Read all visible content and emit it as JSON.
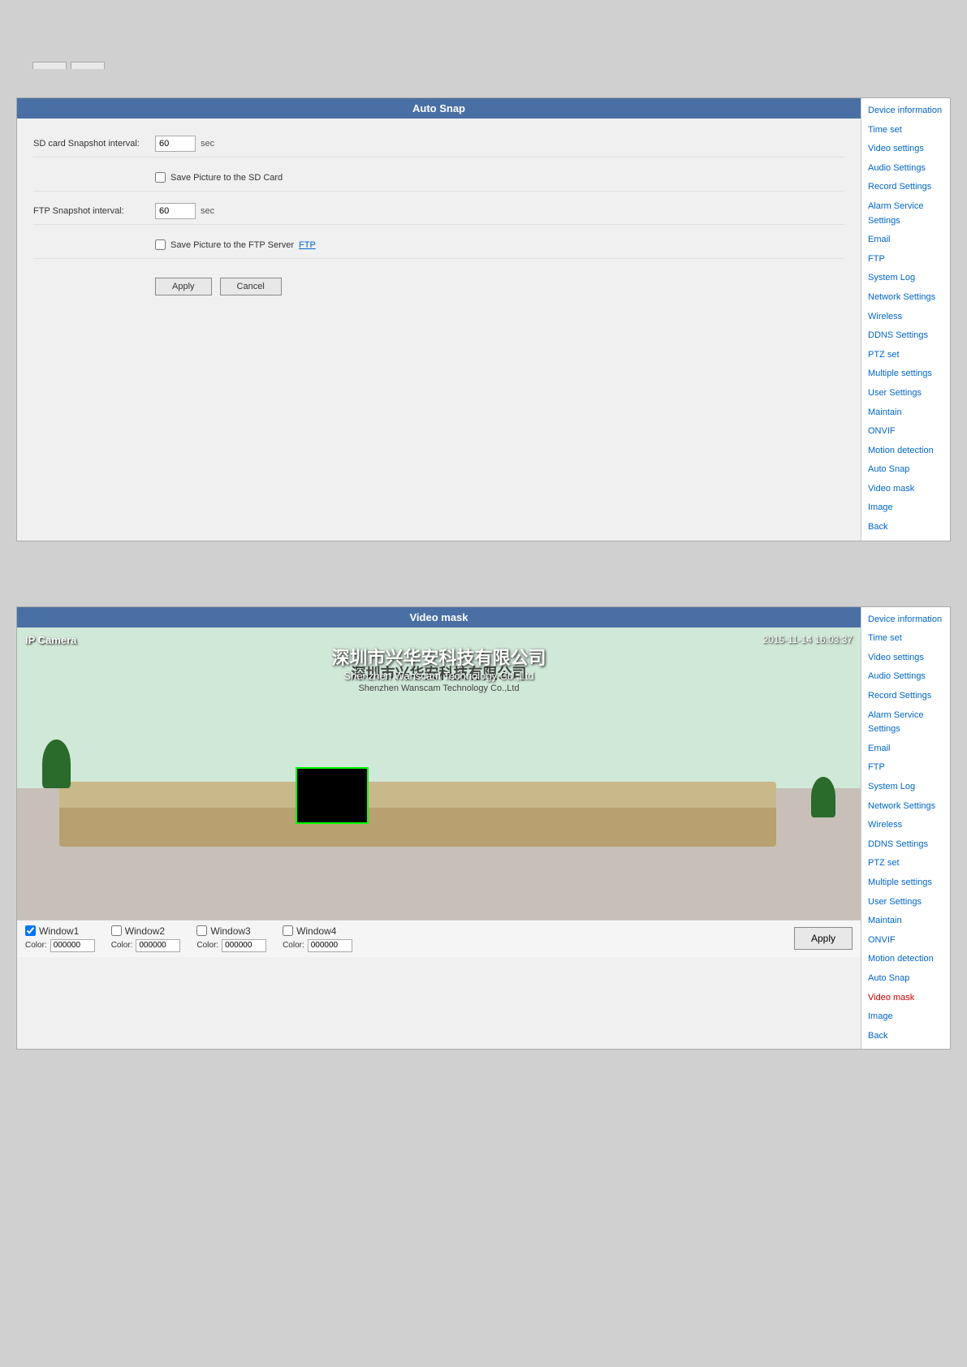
{
  "page": {
    "background": "#d0d0d0"
  },
  "panel1": {
    "header": "Auto Snap",
    "sd_label": "SD card Snapshot interval:",
    "sd_value": "60",
    "sd_unit": "sec",
    "sd_checkbox_label": "Save Picture to the SD Card",
    "ftp_label": "FTP Snapshot interval:",
    "ftp_value": "60",
    "ftp_unit": "sec",
    "ftp_checkbox_label": "Save Picture to the FTP Server",
    "ftp_link": "FTP",
    "apply_btn": "Apply",
    "cancel_btn": "Cancel"
  },
  "panel2": {
    "header": "Video mask",
    "camera_label": "IP Camera",
    "timestamp": "2015-11-14 16:03:37",
    "zh_company": "深圳市兴华安科技有限公司",
    "en_company": "Shenzhen Wanscam Technology Co.,Ltd",
    "window1_label": "Window1",
    "window1_color": "000000",
    "window1_checked": true,
    "window2_label": "Window2",
    "window2_color": "000000",
    "window2_checked": false,
    "window3_label": "Window3",
    "window3_color": "000000",
    "window3_checked": false,
    "window4_label": "Window4",
    "window4_color": "000000",
    "window4_checked": false,
    "apply_btn": "Apply"
  },
  "sidebar1": {
    "items": [
      {
        "label": "Device information",
        "active": false,
        "bold": false
      },
      {
        "label": "Time set",
        "active": false,
        "bold": false
      },
      {
        "label": "Video settings",
        "active": false,
        "bold": false
      },
      {
        "label": "Audio Settings",
        "active": false,
        "bold": false
      },
      {
        "label": "Record Settings",
        "active": false,
        "bold": false
      },
      {
        "label": "Alarm Service Settings",
        "active": false,
        "bold": false
      },
      {
        "label": "Email",
        "active": false,
        "bold": false
      },
      {
        "label": "FTP",
        "active": false,
        "bold": false
      },
      {
        "label": "System Log",
        "active": false,
        "bold": false
      },
      {
        "label": "Network Settings",
        "active": false,
        "bold": false
      },
      {
        "label": "Wireless",
        "active": false,
        "bold": false
      },
      {
        "label": "DDNS Settings",
        "active": false,
        "bold": false
      },
      {
        "label": "PTZ set",
        "active": false,
        "bold": false
      },
      {
        "label": "Multiple settings",
        "active": false,
        "bold": false
      },
      {
        "label": "User Settings",
        "active": false,
        "bold": false
      },
      {
        "label": "Maintain",
        "active": false,
        "bold": false
      },
      {
        "label": "ONVIF",
        "active": false,
        "bold": false
      },
      {
        "label": "Motion detection",
        "active": false,
        "bold": false
      },
      {
        "label": "Auto Snap",
        "active": false,
        "bold": false
      },
      {
        "label": "Video mask",
        "active": false,
        "bold": false
      },
      {
        "label": "Image",
        "active": false,
        "bold": false
      },
      {
        "label": "Back",
        "active": false,
        "bold": false
      }
    ]
  },
  "sidebar2": {
    "items": [
      {
        "label": "Device information",
        "active": false
      },
      {
        "label": "Time set",
        "active": false
      },
      {
        "label": "Video settings",
        "active": false
      },
      {
        "label": "Audio Settings",
        "active": false
      },
      {
        "label": "Record Settings",
        "active": false
      },
      {
        "label": "Alarm Service Settings",
        "active": false
      },
      {
        "label": "Email",
        "active": false
      },
      {
        "label": "FTP",
        "active": false
      },
      {
        "label": "System Log",
        "active": false
      },
      {
        "label": "Network Settings",
        "active": false
      },
      {
        "label": "Wireless",
        "active": false
      },
      {
        "label": "DDNS Settings",
        "active": false
      },
      {
        "label": "PTZ set",
        "active": false
      },
      {
        "label": "Multiple settings",
        "active": false
      },
      {
        "label": "User Settings",
        "active": false
      },
      {
        "label": "Maintain",
        "active": false
      },
      {
        "label": "ONVIF",
        "active": false
      },
      {
        "label": "Motion detection",
        "active": false
      },
      {
        "label": "Auto Snap",
        "active": false
      },
      {
        "label": "Video mask",
        "active": true
      },
      {
        "label": "Image",
        "active": false
      },
      {
        "label": "Back",
        "active": false
      }
    ]
  }
}
